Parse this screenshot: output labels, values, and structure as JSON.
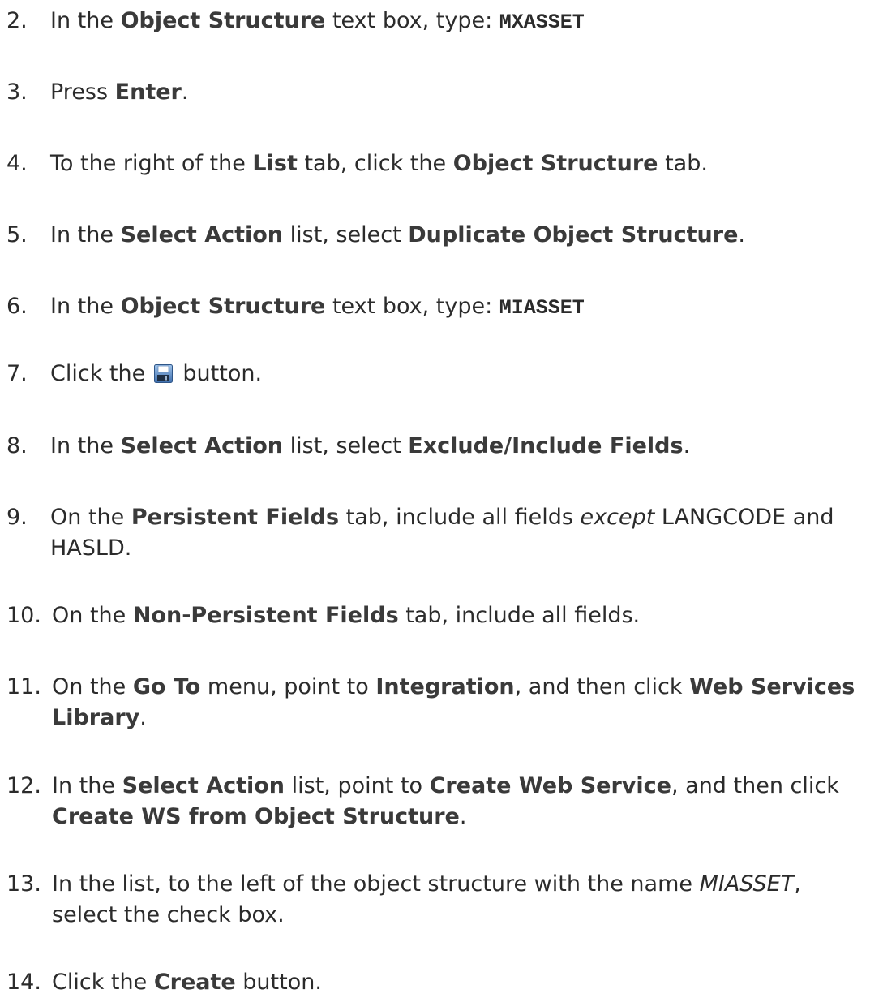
{
  "steps": [
    {
      "num": "2.",
      "a": "In the ",
      "b": "Object Structure",
      "c": " text box, type: ",
      "code": "MXASSET"
    },
    {
      "num": "3.",
      "a": "Press ",
      "b": "Enter",
      "c": "."
    },
    {
      "num": "4.",
      "a": "To the right of the ",
      "b": "List",
      "c": " tab, click the ",
      "d": "Object Structure",
      "e": " tab."
    },
    {
      "num": "5.",
      "a": "In the ",
      "b": "Select Action",
      "c": " list, select ",
      "d": "Duplicate Object Structure",
      "e": "."
    },
    {
      "num": "6.",
      "a": "In the ",
      "b": "Object Structure",
      "c": " text box, type: ",
      "code": "MIASSET"
    },
    {
      "num": "7.",
      "a": "Click the ",
      "icon": "save-icon",
      "c": " button."
    },
    {
      "num": "8.",
      "a": "In the ",
      "b": "Select Action",
      "c": " list, select ",
      "d": "Exclude/Include Fields",
      "e": "."
    },
    {
      "num": "9.",
      "a": "On the ",
      "b": "Persistent Fields",
      "c": " tab, include all fields ",
      "i": "except",
      "e": " LANGCODE and",
      "line2": "HASLD."
    },
    {
      "num": "10.",
      "a": "On the ",
      "b": "Non-Persistent Fields",
      "c": " tab, include all fields."
    },
    {
      "num": "11.",
      "a": "On the ",
      "b": "Go To",
      "c": " menu, point to ",
      "d": "Integration",
      "e": ", and then click ",
      "f": "Web Services",
      "line2b": "Library",
      "line2c": "."
    },
    {
      "num": "12.",
      "a": "In the ",
      "b": "Select Action",
      "c": " list, point to ",
      "d": "Create Web Service",
      "e": ", and then click",
      "line2b": "Create WS from Object Structure",
      "line2c": "."
    },
    {
      "num": "13.",
      "a": "In the list, to the left of the object structure with the name ",
      "i": "MIASSET",
      "e": ",",
      "line2": "select the check box."
    },
    {
      "num": "14.",
      "a": "Click the ",
      "b": "Create",
      "c": " button."
    }
  ]
}
